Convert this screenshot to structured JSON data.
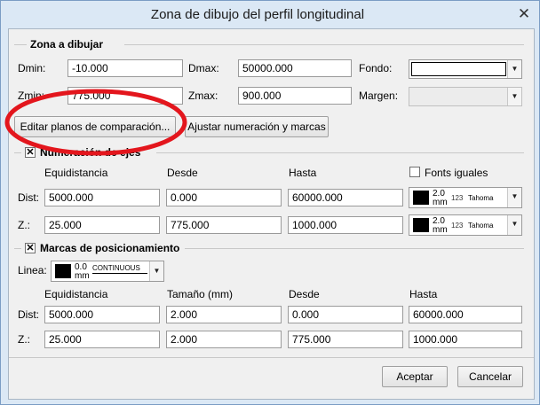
{
  "window": {
    "title": "Zona de dibujo del perfil longitudinal",
    "close_glyph": "✕"
  },
  "zona": {
    "heading": "Zona a dibujar",
    "dmin_label": "Dmin:",
    "dmin_value": "-10.000",
    "dmax_label": "Dmax:",
    "dmax_value": "50000.000",
    "fondo_label": "Fondo:",
    "zmin_label": "Zmin:",
    "zmin_value": "775.000",
    "zmax_label": "Zmax:",
    "zmax_value": "900.000",
    "margen_label": "Margen:",
    "editar_button": "Editar planos de comparación...",
    "ajustar_button": "Ajustar numeración y marcas"
  },
  "numeracion": {
    "heading": "Numeración de ejes",
    "checked": true,
    "col_equidistancia": "Equidistancia",
    "col_desde": "Desde",
    "col_hasta": "Hasta",
    "fonts_iguales": "Fonts iguales",
    "dist_label": "Dist:",
    "dist_equidistancia": "5000.000",
    "dist_desde": "0.000",
    "dist_hasta": "60000.000",
    "z_label": "Z.:",
    "z_equidistancia": "25.000",
    "z_desde": "775.000",
    "z_hasta": "1000.000",
    "dist_font": {
      "size": "2.0",
      "unit": "mm",
      "sample": "123",
      "name": "Tahoma"
    },
    "z_font": {
      "size": "2.0",
      "unit": "mm",
      "sample": "123",
      "name": "Tahoma"
    }
  },
  "marcas": {
    "heading": "Marcas de posicionamiento",
    "checked": true,
    "linea_label": "Linea:",
    "linea_width": "0.0",
    "linea_unit": "mm",
    "linea_type": "CONTINUOUS",
    "col_equidistancia": "Equidistancia",
    "col_tamano": "Tamaño (mm)",
    "col_desde": "Desde",
    "col_hasta": "Hasta",
    "dist_label": "Dist:",
    "dist_equidistancia": "5000.000",
    "dist_tamano": "2.000",
    "dist_desde": "0.000",
    "dist_hasta": "60000.000",
    "z_label": "Z.:",
    "z_equidistancia": "25.000",
    "z_tamano": "2.000",
    "z_desde": "775.000",
    "z_hasta": "1000.000"
  },
  "footer": {
    "aceptar": "Aceptar",
    "cancelar": "Cancelar"
  },
  "colors": {
    "annotation_red": "#e3161d",
    "fondo_color": "#ffffff"
  }
}
